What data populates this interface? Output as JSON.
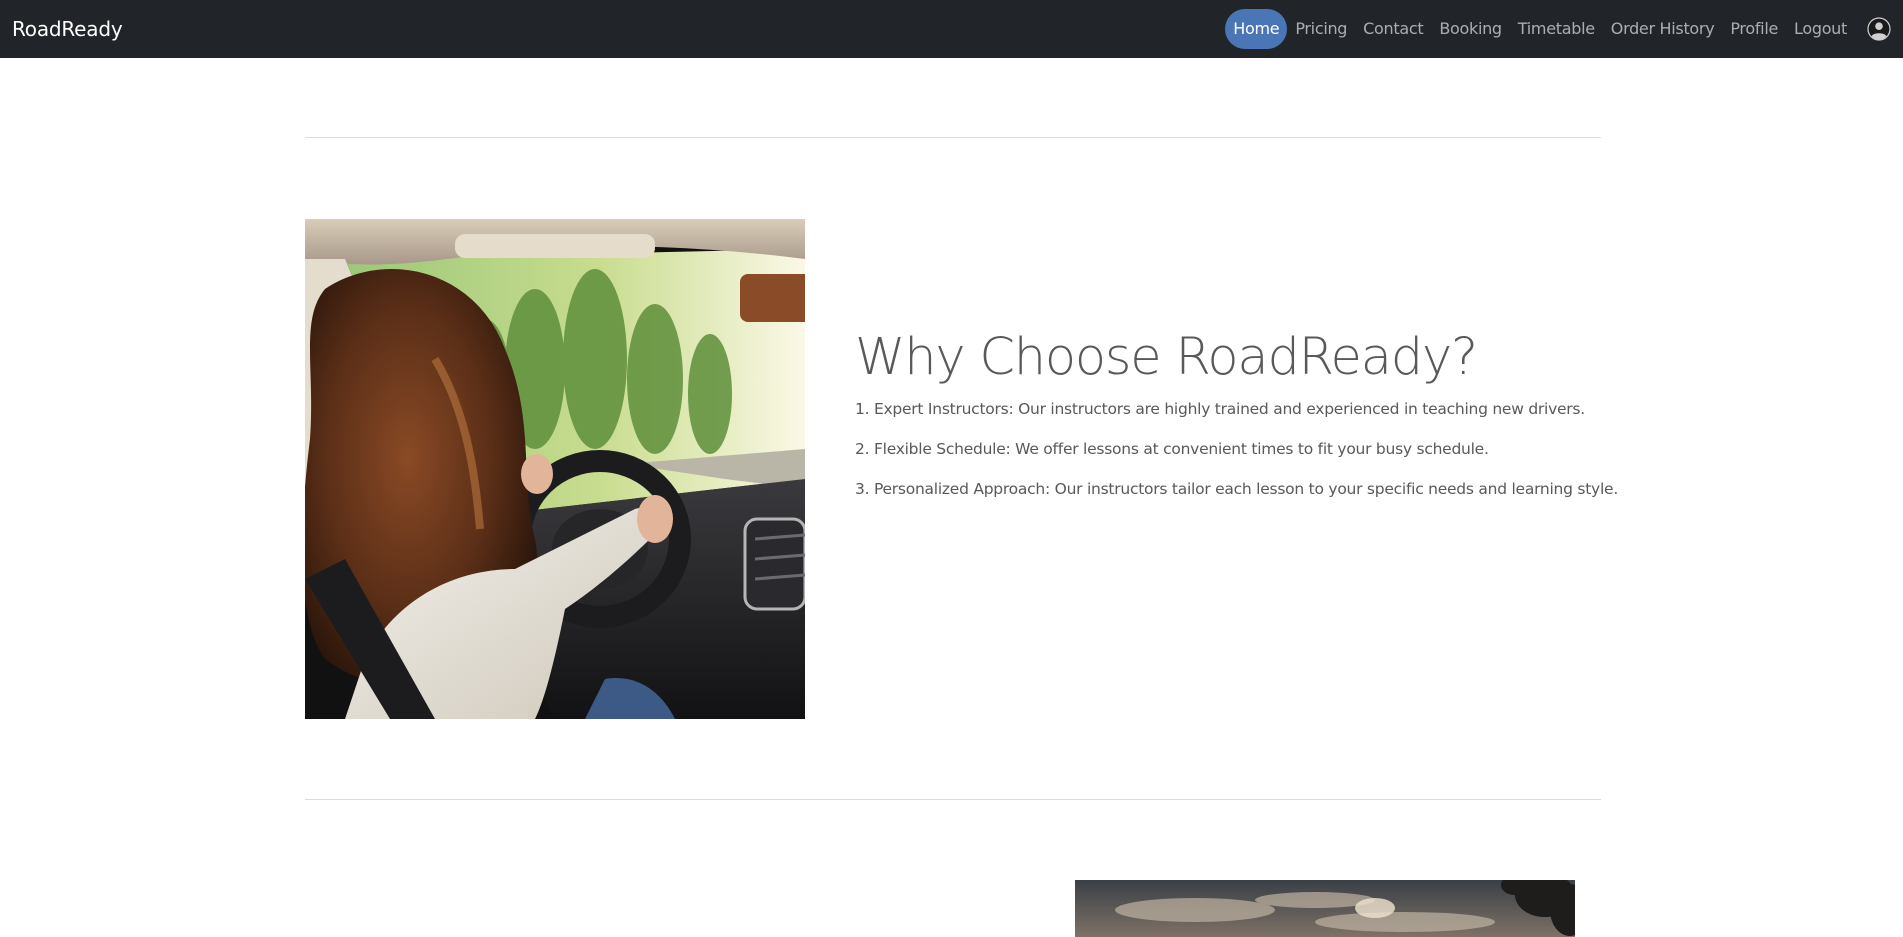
{
  "navbar": {
    "brand": "RoadReady",
    "links": [
      {
        "label": "Home",
        "active": true
      },
      {
        "label": "Pricing"
      },
      {
        "label": "Contact"
      },
      {
        "label": "Booking"
      },
      {
        "label": "Timetable"
      },
      {
        "label": "Order History"
      },
      {
        "label": "Profile"
      },
      {
        "label": "Logout"
      }
    ],
    "avatar_icon": "user-avatar-icon"
  },
  "why": {
    "heading": "Why Choose RoadReady?",
    "items": [
      "1. Expert Instructors: Our instructors are highly trained and experienced in teaching new drivers.",
      "2. Flexible Schedule: We offer lessons at convenient times to fit your busy schedule.",
      "3. Personalized Approach: Our instructors tailor each lesson to your specific needs and learning style."
    ],
    "image_subject": "woman-driving-car-photo"
  },
  "next_section": {
    "image_subject": "sunset-sky-photo"
  },
  "colors": {
    "navbar_bg": "#212529",
    "active_pill": "#4a76b8",
    "text": "#595959",
    "divider": "#dcdcdc"
  }
}
